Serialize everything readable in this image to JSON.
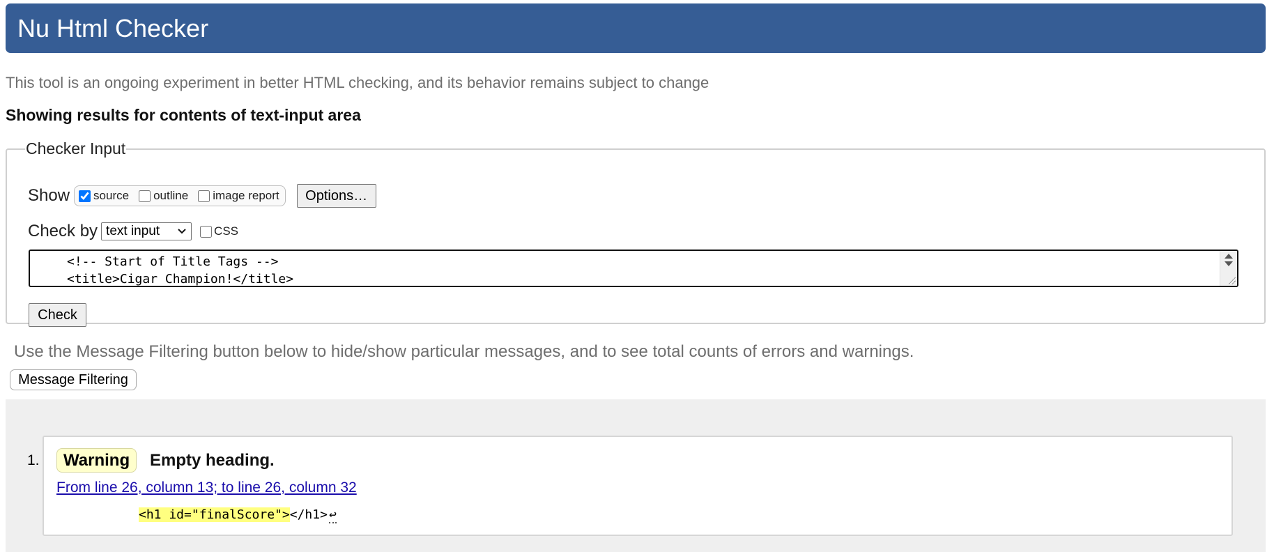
{
  "header": {
    "title": "Nu Html Checker",
    "background": "#365d95"
  },
  "tagline": "This tool is an ongoing experiment in better HTML checking, and its behavior remains subject to change",
  "results_heading": "Showing results for contents of text-input area",
  "checker_input": {
    "legend": "Checker Input",
    "show_label": "Show",
    "show_options": [
      {
        "label": "source",
        "checked": true
      },
      {
        "label": "outline",
        "checked": false
      },
      {
        "label": "image report",
        "checked": false
      }
    ],
    "options_button": "Options…",
    "check_by_label": "Check by",
    "check_by_value": "text input",
    "css_label": "CSS",
    "css_checked": false,
    "textarea_lines": [
      "<!-- Start of Title Tags -->",
      "<title>Cigar Champion!</title>"
    ],
    "check_button": "Check"
  },
  "filter": {
    "note": "Use the Message Filtering button below to hide/show particular messages, and to see total counts of errors and warnings.",
    "button": "Message Filtering"
  },
  "messages": [
    {
      "number": "1.",
      "type": "Warning",
      "type_color": "#ffffcc",
      "title": "Empty heading.",
      "location": "From line 26, column 13; to line 26, column 32",
      "code_highlight": "<h1 id=\"finalScore\">",
      "code_rest": "</h1>",
      "code_eol": "↩"
    }
  ]
}
